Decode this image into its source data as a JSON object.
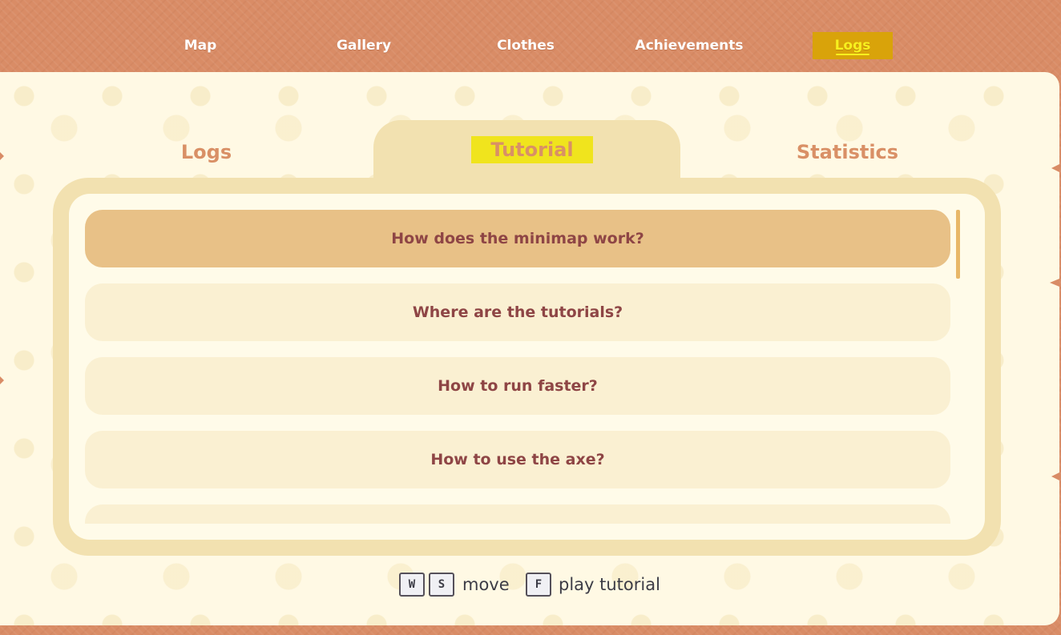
{
  "top_nav": {
    "items": [
      {
        "label": "Map"
      },
      {
        "label": "Gallery"
      },
      {
        "label": "Clothes"
      },
      {
        "label": "Achievements"
      },
      {
        "label": "Logs"
      }
    ],
    "active": "Logs"
  },
  "sub_tabs": {
    "items": [
      {
        "label": "Logs"
      },
      {
        "label": "Tutorial"
      },
      {
        "label": "Statistics"
      }
    ],
    "active": "Tutorial"
  },
  "tutorial_list": {
    "items": [
      {
        "label": "How does the minimap work?"
      },
      {
        "label": "Where are the tutorials?"
      },
      {
        "label": "How to run faster?"
      },
      {
        "label": "How to use the axe?"
      },
      {
        "label": ""
      }
    ],
    "selected_index": 0
  },
  "hints": {
    "key_w": "W",
    "key_s": "S",
    "move_label": "move",
    "key_f": "F",
    "play_label": "play tutorial"
  },
  "colors": {
    "background": "#d98c66",
    "panel": "#fff9e4",
    "frame": "#f2e1b0",
    "item": "#faf0d2",
    "item_selected": "#e8c187",
    "item_text": "#8e4545",
    "tab_text": "#d99066",
    "highlight": "#f0e41d"
  }
}
